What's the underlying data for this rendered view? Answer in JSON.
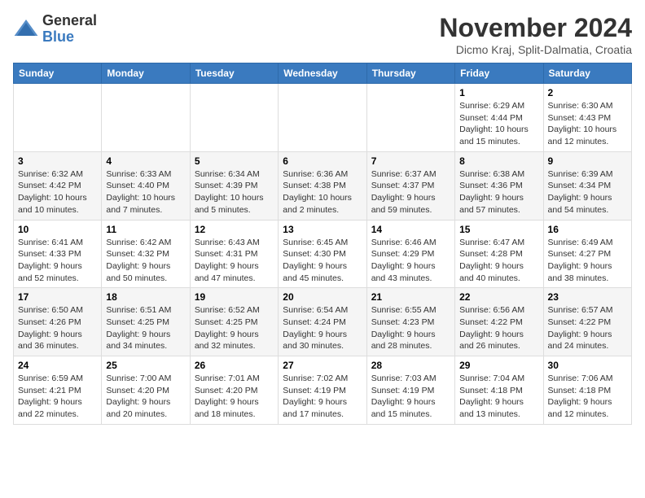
{
  "header": {
    "logo_general": "General",
    "logo_blue": "Blue",
    "month_title": "November 2024",
    "location": "Dicmo Kraj, Split-Dalmatia, Croatia"
  },
  "days_of_week": [
    "Sunday",
    "Monday",
    "Tuesday",
    "Wednesday",
    "Thursday",
    "Friday",
    "Saturday"
  ],
  "weeks": [
    {
      "days": [
        {
          "number": "",
          "info": ""
        },
        {
          "number": "",
          "info": ""
        },
        {
          "number": "",
          "info": ""
        },
        {
          "number": "",
          "info": ""
        },
        {
          "number": "",
          "info": ""
        },
        {
          "number": "1",
          "info": "Sunrise: 6:29 AM\nSunset: 4:44 PM\nDaylight: 10 hours and 15 minutes."
        },
        {
          "number": "2",
          "info": "Sunrise: 6:30 AM\nSunset: 4:43 PM\nDaylight: 10 hours and 12 minutes."
        }
      ]
    },
    {
      "days": [
        {
          "number": "3",
          "info": "Sunrise: 6:32 AM\nSunset: 4:42 PM\nDaylight: 10 hours and 10 minutes."
        },
        {
          "number": "4",
          "info": "Sunrise: 6:33 AM\nSunset: 4:40 PM\nDaylight: 10 hours and 7 minutes."
        },
        {
          "number": "5",
          "info": "Sunrise: 6:34 AM\nSunset: 4:39 PM\nDaylight: 10 hours and 5 minutes."
        },
        {
          "number": "6",
          "info": "Sunrise: 6:36 AM\nSunset: 4:38 PM\nDaylight: 10 hours and 2 minutes."
        },
        {
          "number": "7",
          "info": "Sunrise: 6:37 AM\nSunset: 4:37 PM\nDaylight: 9 hours and 59 minutes."
        },
        {
          "number": "8",
          "info": "Sunrise: 6:38 AM\nSunset: 4:36 PM\nDaylight: 9 hours and 57 minutes."
        },
        {
          "number": "9",
          "info": "Sunrise: 6:39 AM\nSunset: 4:34 PM\nDaylight: 9 hours and 54 minutes."
        }
      ]
    },
    {
      "days": [
        {
          "number": "10",
          "info": "Sunrise: 6:41 AM\nSunset: 4:33 PM\nDaylight: 9 hours and 52 minutes."
        },
        {
          "number": "11",
          "info": "Sunrise: 6:42 AM\nSunset: 4:32 PM\nDaylight: 9 hours and 50 minutes."
        },
        {
          "number": "12",
          "info": "Sunrise: 6:43 AM\nSunset: 4:31 PM\nDaylight: 9 hours and 47 minutes."
        },
        {
          "number": "13",
          "info": "Sunrise: 6:45 AM\nSunset: 4:30 PM\nDaylight: 9 hours and 45 minutes."
        },
        {
          "number": "14",
          "info": "Sunrise: 6:46 AM\nSunset: 4:29 PM\nDaylight: 9 hours and 43 minutes."
        },
        {
          "number": "15",
          "info": "Sunrise: 6:47 AM\nSunset: 4:28 PM\nDaylight: 9 hours and 40 minutes."
        },
        {
          "number": "16",
          "info": "Sunrise: 6:49 AM\nSunset: 4:27 PM\nDaylight: 9 hours and 38 minutes."
        }
      ]
    },
    {
      "days": [
        {
          "number": "17",
          "info": "Sunrise: 6:50 AM\nSunset: 4:26 PM\nDaylight: 9 hours and 36 minutes."
        },
        {
          "number": "18",
          "info": "Sunrise: 6:51 AM\nSunset: 4:25 PM\nDaylight: 9 hours and 34 minutes."
        },
        {
          "number": "19",
          "info": "Sunrise: 6:52 AM\nSunset: 4:25 PM\nDaylight: 9 hours and 32 minutes."
        },
        {
          "number": "20",
          "info": "Sunrise: 6:54 AM\nSunset: 4:24 PM\nDaylight: 9 hours and 30 minutes."
        },
        {
          "number": "21",
          "info": "Sunrise: 6:55 AM\nSunset: 4:23 PM\nDaylight: 9 hours and 28 minutes."
        },
        {
          "number": "22",
          "info": "Sunrise: 6:56 AM\nSunset: 4:22 PM\nDaylight: 9 hours and 26 minutes."
        },
        {
          "number": "23",
          "info": "Sunrise: 6:57 AM\nSunset: 4:22 PM\nDaylight: 9 hours and 24 minutes."
        }
      ]
    },
    {
      "days": [
        {
          "number": "24",
          "info": "Sunrise: 6:59 AM\nSunset: 4:21 PM\nDaylight: 9 hours and 22 minutes."
        },
        {
          "number": "25",
          "info": "Sunrise: 7:00 AM\nSunset: 4:20 PM\nDaylight: 9 hours and 20 minutes."
        },
        {
          "number": "26",
          "info": "Sunrise: 7:01 AM\nSunset: 4:20 PM\nDaylight: 9 hours and 18 minutes."
        },
        {
          "number": "27",
          "info": "Sunrise: 7:02 AM\nSunset: 4:19 PM\nDaylight: 9 hours and 17 minutes."
        },
        {
          "number": "28",
          "info": "Sunrise: 7:03 AM\nSunset: 4:19 PM\nDaylight: 9 hours and 15 minutes."
        },
        {
          "number": "29",
          "info": "Sunrise: 7:04 AM\nSunset: 4:18 PM\nDaylight: 9 hours and 13 minutes."
        },
        {
          "number": "30",
          "info": "Sunrise: 7:06 AM\nSunset: 4:18 PM\nDaylight: 9 hours and 12 minutes."
        }
      ]
    }
  ]
}
